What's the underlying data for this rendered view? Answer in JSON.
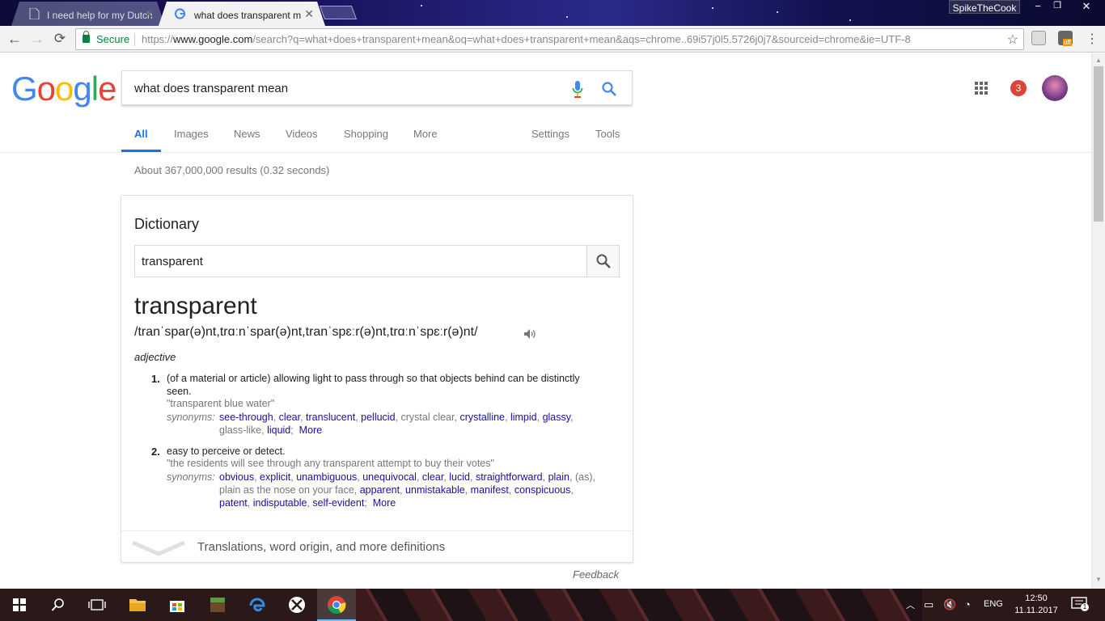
{
  "browser": {
    "tabs": [
      {
        "title": "I need help for my Dutch",
        "active": false
      },
      {
        "title": "what does transparent m",
        "active": true
      }
    ],
    "profile_name": "SpikeTheCook",
    "window_buttons": [
      "−",
      "❐",
      "✕"
    ],
    "secure_label": "Secure",
    "url_scheme": "https://",
    "url_host": "www.google.com",
    "url_path": "/search?q=what+does+transparent+mean&oq=what+does+transparent+mean&aqs=chrome..69i57j0l5.5726j0j7&sourceid=chrome&ie=UTF-8",
    "extension_badge": "off"
  },
  "google": {
    "logo_letters": [
      {
        "ch": "G",
        "color": "#4285f4"
      },
      {
        "ch": "o",
        "color": "#ea4335"
      },
      {
        "ch": "o",
        "color": "#fbbc05"
      },
      {
        "ch": "g",
        "color": "#4285f4"
      },
      {
        "ch": "l",
        "color": "#34a853"
      },
      {
        "ch": "e",
        "color": "#ea4335"
      }
    ],
    "query": "what does transparent mean",
    "notification_count": "3",
    "nav": {
      "all": "All",
      "images": "Images",
      "news": "News",
      "videos": "Videos",
      "shopping": "Shopping",
      "more": "More",
      "settings": "Settings",
      "tools": "Tools"
    },
    "result_stats": "About 367,000,000 results (0.32 seconds)"
  },
  "dictionary": {
    "title": "Dictionary",
    "input_value": "transparent",
    "word": "transparent",
    "phonetic": "/tranˈspar(ə)nt,trɑːnˈspar(ə)nt,tranˈspɛːr(ə)nt,trɑːnˈspɛːr(ə)nt/",
    "part_of_speech": "adjective",
    "synonyms_label": "synonyms:",
    "definitions": [
      {
        "num": "1.",
        "line1": "(of a material or article) allowing light to pass through so that objects behind can be distinctly",
        "line2": "seen.",
        "example": "\"transparent blue water\"",
        "syn_row1": [
          {
            "w": "see-through",
            "link": true
          },
          {
            "w": "clear",
            "link": true
          },
          {
            "w": "translucent",
            "link": true
          },
          {
            "w": "pellucid",
            "link": true
          },
          {
            "w": "crystal clear",
            "link": false
          },
          {
            "w": "crystalline",
            "link": true
          },
          {
            "w": "limpid",
            "link": true
          },
          {
            "w": "glassy",
            "link": true
          }
        ],
        "syn_row2": [
          {
            "w": "glass-like",
            "link": false
          },
          {
            "w": "liquid",
            "link": true
          }
        ],
        "more": "More"
      },
      {
        "num": "2.",
        "line1": "easy to perceive or detect.",
        "example": "\"the residents will see through any transparent attempt to buy their votes\"",
        "syn_row1": [
          {
            "w": "obvious",
            "link": true
          },
          {
            "w": "explicit",
            "link": true
          },
          {
            "w": "unambiguous",
            "link": true
          },
          {
            "w": "unequivocal",
            "link": true
          },
          {
            "w": "clear",
            "link": true
          },
          {
            "w": "lucid",
            "link": true
          },
          {
            "w": "straightforward",
            "link": true
          },
          {
            "w": "plain",
            "link": true
          },
          {
            "w": "(as)",
            "link": false
          }
        ],
        "syn_row2": [
          {
            "w": "plain as the nose on your face",
            "link": false
          },
          {
            "w": "apparent",
            "link": true
          },
          {
            "w": "unmistakable",
            "link": true
          },
          {
            "w": "manifest",
            "link": true
          },
          {
            "w": "conspicuous",
            "link": true
          }
        ],
        "syn_row3": [
          {
            "w": "patent",
            "link": true
          },
          {
            "w": "indisputable",
            "link": true
          },
          {
            "w": "self-evident",
            "link": true
          }
        ],
        "more": "More"
      }
    ],
    "more_definitions": "Translations, word origin, and more definitions",
    "feedback": "Feedback"
  },
  "taskbar": {
    "language": "ENG",
    "time": "12:50",
    "date": "11.11.2017",
    "notification_count": "1"
  },
  "colors": {
    "accent": "#1a73e8",
    "link": "#1a0dab",
    "secure_green": "#0b8043"
  }
}
